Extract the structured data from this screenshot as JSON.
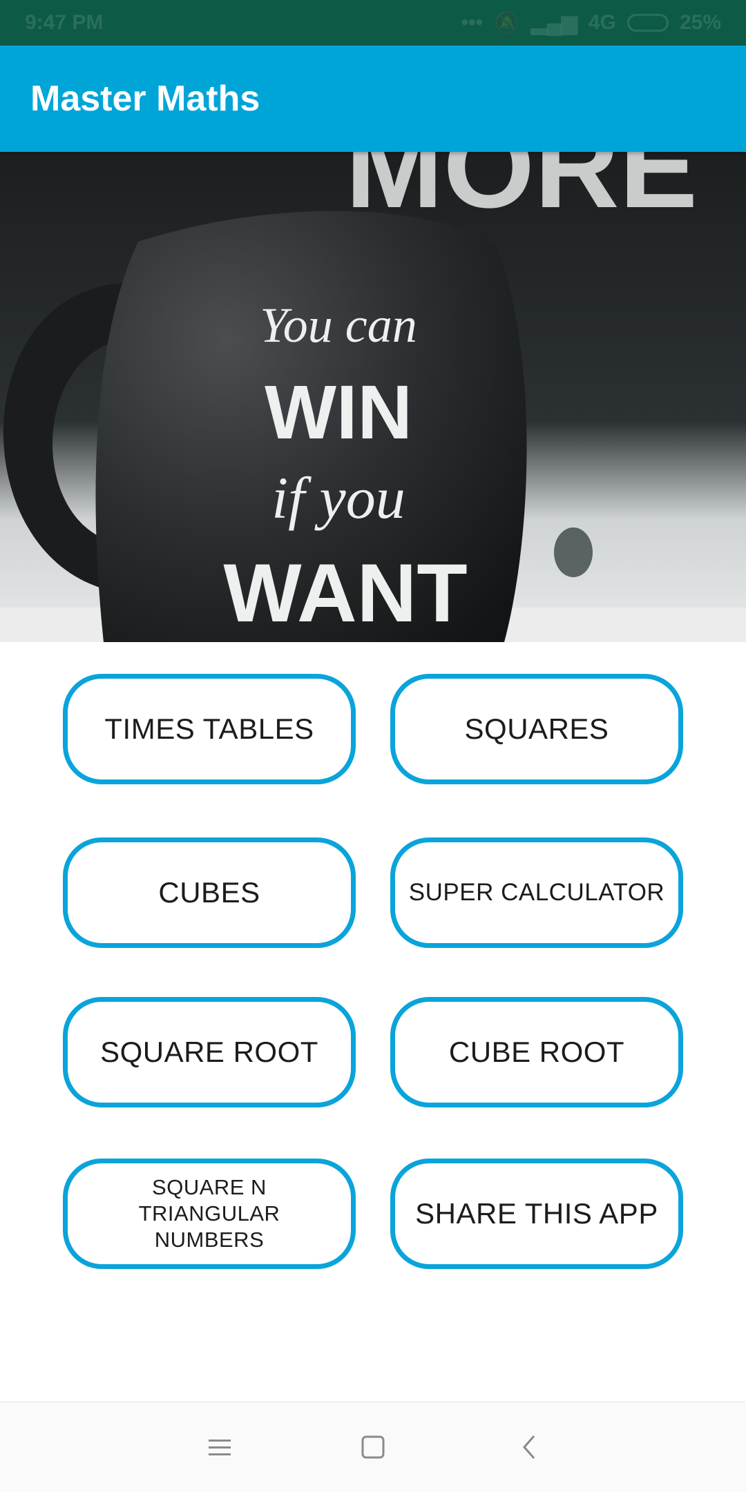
{
  "status_bar": {
    "time": "9:47 PM",
    "network": "4G",
    "battery": "25%",
    "icons": [
      "dots-icon",
      "mute-icon",
      "signal-icon",
      "volte-icon",
      "battery-icon"
    ]
  },
  "app_bar": {
    "title": "Master Maths"
  },
  "hero": {
    "image_text": [
      "You can",
      "WIN",
      "if you",
      "WANT",
      "MORE"
    ]
  },
  "menu": {
    "buttons": [
      {
        "label": "TIMES TABLES"
      },
      {
        "label": "SQUARES"
      },
      {
        "label": "CUBES"
      },
      {
        "label": "SUPER CALCULATOR"
      },
      {
        "label": "SQUARE ROOT"
      },
      {
        "label": "CUBE ROOT"
      },
      {
        "label": "SQUARE N TRIANGULAR NUMBERS"
      },
      {
        "label": "SHARE THIS APP"
      }
    ]
  },
  "nav_bar": {
    "icons": [
      "menu-icon",
      "home-icon",
      "back-icon"
    ]
  },
  "colors": {
    "status_bar": "#0d5a47",
    "app_bar": "#00a5d8",
    "button_border": "#0aa4da",
    "button_text": "#1c1c1c"
  }
}
